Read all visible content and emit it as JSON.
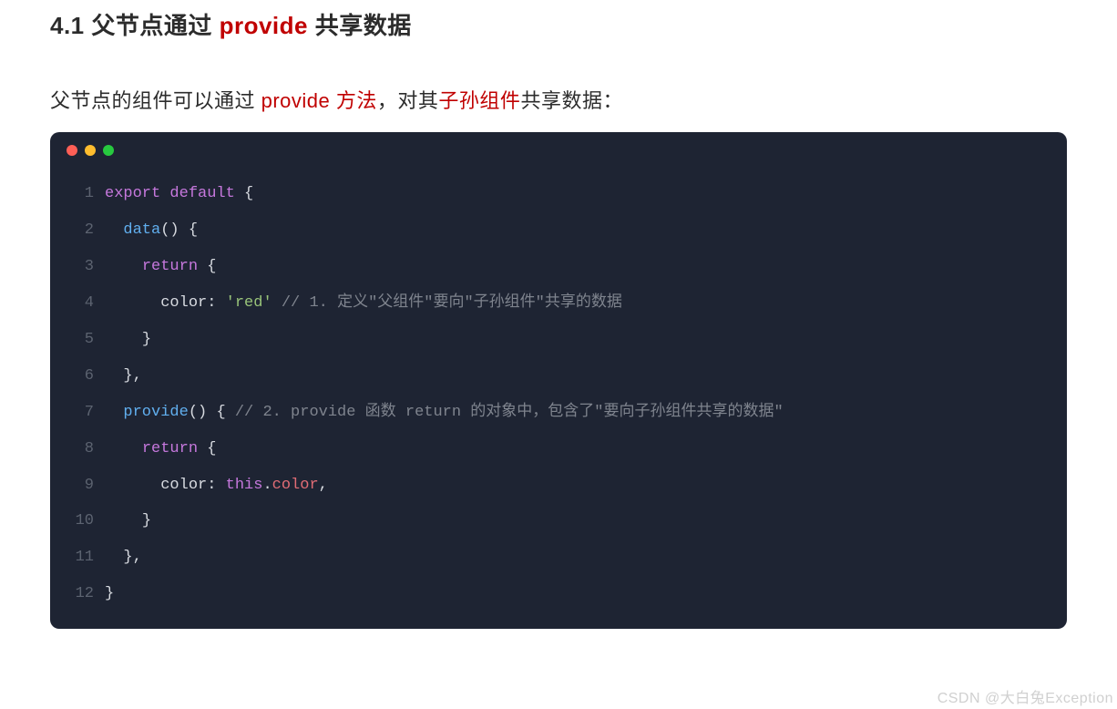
{
  "heading": {
    "prefix": "4.1 父节点通过 ",
    "highlight": "provide",
    "suffix": " 共享数据"
  },
  "paragraph": {
    "p1": "父节点的组件可以通过 ",
    "hl1": "provide 方法",
    "p2": "，对其",
    "hl2": "子孙组件",
    "p3": "共享数据："
  },
  "code": {
    "lines": [
      {
        "n": "1",
        "kw1": "export",
        "sp1": " ",
        "kw2": "default",
        "sp2": " ",
        "punc1": "{"
      },
      {
        "n": "2",
        "ind": "  ",
        "fn": "data",
        "punc1": "()",
        "sp1": " ",
        "punc2": "{"
      },
      {
        "n": "3",
        "ind": "    ",
        "kw": "return",
        "sp1": " ",
        "punc1": "{"
      },
      {
        "n": "4",
        "ind": "      ",
        "prop": "color",
        "punc1": ":",
        "sp1": " ",
        "str": "'red'",
        "sp2": " ",
        "cmt": "// 1. 定义\"父组件\"要向\"子孙组件\"共享的数据"
      },
      {
        "n": "5",
        "ind": "    ",
        "punc1": "}"
      },
      {
        "n": "6",
        "ind": "  ",
        "punc1": "},"
      },
      {
        "n": "7",
        "ind": "  ",
        "fn": "provide",
        "punc1": "()",
        "sp1": " ",
        "punc2": "{",
        "sp2": " ",
        "cmt": "// 2. provide 函数 return 的对象中，包含了\"要向子孙组件共享的数据\""
      },
      {
        "n": "8",
        "ind": "    ",
        "kw": "return",
        "sp1": " ",
        "punc1": "{"
      },
      {
        "n": "9",
        "ind": "      ",
        "prop": "color",
        "punc1": ":",
        "sp1": " ",
        "kw": "this",
        "punc2": ".",
        "prop2": "color",
        "punc3": ","
      },
      {
        "n": "10",
        "ind": "    ",
        "punc1": "}"
      },
      {
        "n": "11",
        "ind": "  ",
        "punc1": "},"
      },
      {
        "n": "12",
        "punc1": "}"
      }
    ]
  },
  "watermark": "CSDN @大白兔Exception"
}
